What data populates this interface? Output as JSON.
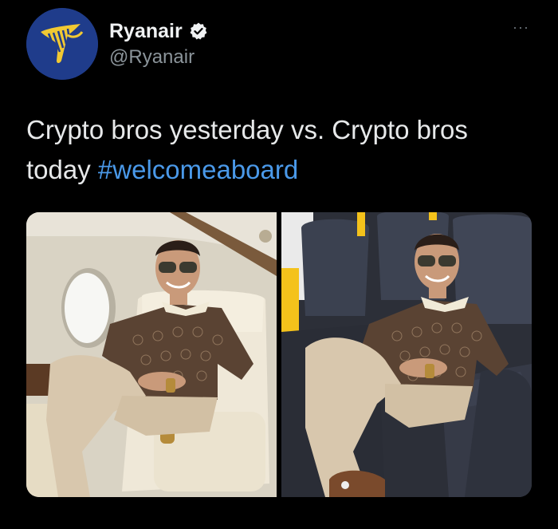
{
  "account": {
    "display_name": "Ryanair",
    "handle": "@Ryanair",
    "verified_icon": "verified-badge-icon",
    "avatar_icon": "ryanair-harp-logo",
    "brand_color": "#1f3c8b",
    "accent_color": "#f1c933"
  },
  "menu": {
    "more_label": "···"
  },
  "tweet": {
    "text": "Crypto bros yesterday vs. Crypto bros today ",
    "hashtag": "#welcomeaboard",
    "hashtag_color": "#4a99e9"
  },
  "media": {
    "images": [
      {
        "name": "private-jet-photo"
      },
      {
        "name": "budget-airline-photo"
      }
    ]
  }
}
